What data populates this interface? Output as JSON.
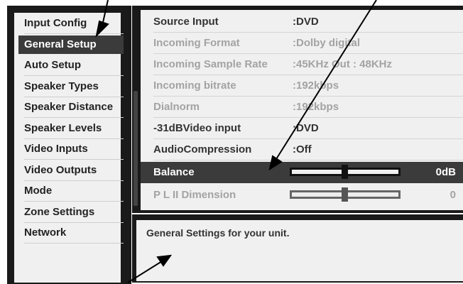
{
  "menu": {
    "items": [
      {
        "label": "Input Config"
      },
      {
        "label": "General Setup"
      },
      {
        "label": "Auto Setup"
      },
      {
        "label": "Speaker Types"
      },
      {
        "label": "Speaker Distance"
      },
      {
        "label": "Speaker Levels"
      },
      {
        "label": "Video Inputs"
      },
      {
        "label": "Video Outputs"
      },
      {
        "label": "Mode"
      },
      {
        "label": "Zone Settings"
      },
      {
        "label": "Network"
      }
    ],
    "selected": "General Setup"
  },
  "info": {
    "rows": [
      {
        "label": "Source Input",
        "value": ":DVD"
      },
      {
        "label": "Incoming Format",
        "value": ":Dolby digital"
      },
      {
        "label": "Incoming Sample Rate",
        "value": ":45KHz Out : 48KHz"
      },
      {
        "label": "Incoming bitrate",
        "value": ":192kbps"
      },
      {
        "label": "Dialnorm",
        "value": ":192kbps"
      },
      {
        "label": "-31dBVideo input",
        "value": ":DVD"
      },
      {
        "label": "AudioCompression",
        "value": ":Off"
      }
    ],
    "sliders": [
      {
        "label": "Balance",
        "value": "0dB",
        "level": 0.5
      },
      {
        "label": "P L II Dimension",
        "value": "0",
        "level": 0.5
      }
    ]
  },
  "help": {
    "text": "General Settings for your unit."
  },
  "colors": {
    "frame": "#1a1a1a",
    "panel_bg": "#f0f0f0",
    "selected_bg": "#3b3b3b",
    "dim_text": "#a3a3a3"
  }
}
